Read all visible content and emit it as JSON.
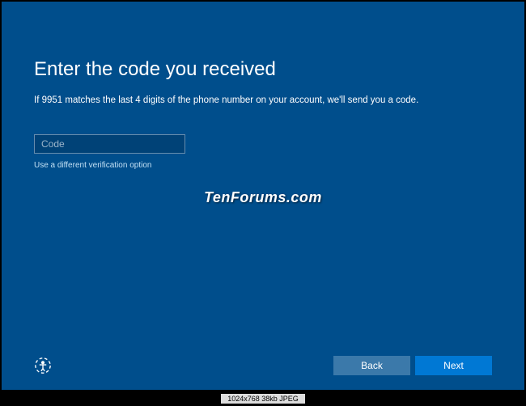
{
  "title": "Enter the code you received",
  "instruction": "If 9951 matches the last 4 digits of the phone number on your account, we'll send you a code.",
  "input": {
    "placeholder": "Code",
    "value": ""
  },
  "alt_link": "Use a different verification option",
  "watermark": "TenForums.com",
  "buttons": {
    "back": "Back",
    "next": "Next"
  },
  "meta": "1024x768  38kb  JPEG"
}
